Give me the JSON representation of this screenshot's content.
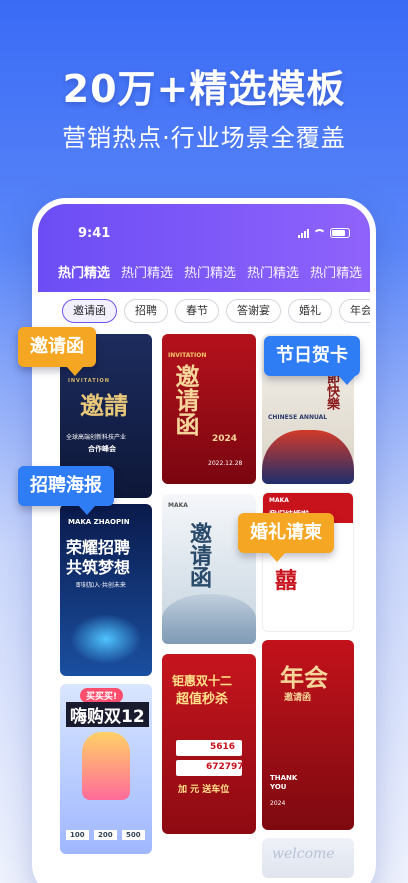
{
  "header": {
    "title": "20万+精选模板",
    "subtitle": "营销热点·行业场景全覆盖"
  },
  "status_bar": {
    "time": "9:41"
  },
  "tabs": [
    "热门精选",
    "热门精选",
    "热门精选",
    "热门精选",
    "热门精选"
  ],
  "chips": [
    "邀请函",
    "招聘",
    "春节",
    "答谢宴",
    "婚礼",
    "年会"
  ],
  "callouts": {
    "invitation": "邀请函",
    "holiday_card": "节日贺卡",
    "recruit_poster": "招聘海报",
    "wedding": "婚礼请柬"
  },
  "cards": {
    "c1_line1": "INVITATION",
    "c1_title": "邀請",
    "c1_sub": "全球高端创新科技产业",
    "c1_sub2": "合作峰会",
    "c2_title": "邀请函",
    "c2_en": "INVITATION",
    "c2_year": "2024",
    "c2_date": "2022.12.28",
    "c3_title": "春節快樂",
    "c3_en": "CHINESE ANNUAL",
    "c4_brand": "MAKA ZHAOPIN",
    "c4_title1": "荣耀招聘",
    "c4_title2": "共筑梦想",
    "c4_sub": "即刻加入·共创未来",
    "c5_brand": "MAKA",
    "c5_title": "邀请函",
    "c6_brand": "MAKA",
    "c6_title": "我们结婚啦",
    "c6_symbol": "囍",
    "c7_tag": "买买买!",
    "c7_title": "嗨购双12",
    "c7_prices": [
      "100",
      "200",
      "500"
    ],
    "c8_title1": "钜惠双十二",
    "c8_title2": "超值秒杀",
    "c8_price1": "5616",
    "c8_price2": "672797",
    "c8_footer": "加 元 送车位",
    "c9_title": "年会",
    "c9_sub": "邀请函",
    "c9_en1": "THANK",
    "c9_en2": "YOU",
    "c9_year": "2024",
    "c10_text": "welcome"
  }
}
